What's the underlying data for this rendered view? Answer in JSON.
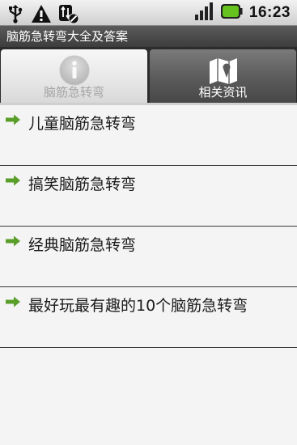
{
  "status_bar": {
    "time": "16:23",
    "icons": [
      "usb-icon",
      "warning-icon",
      "sync-disabled-icon",
      "signal-icon",
      "battery-icon"
    ]
  },
  "app": {
    "title": "脑筋急转弯大全及答案"
  },
  "tabs": [
    {
      "label": "脑筋急转弯",
      "icon": "info-icon",
      "active": true
    },
    {
      "label": "相关资讯",
      "icon": "map-icon",
      "active": false
    }
  ],
  "list": {
    "items": [
      {
        "label": "儿童脑筋急转弯"
      },
      {
        "label": "搞笑脑筋急转弯"
      },
      {
        "label": "经典脑筋急转弯"
      },
      {
        "label": "最好玩最有趣的10个脑筋急转弯"
      }
    ],
    "item_icon": "green-arrow-icon"
  },
  "colors": {
    "title_bar": "#4a4a4a",
    "active_tab": "#e6e6e6",
    "inactive_tab": "#5a5a5a",
    "arrow": "#5a9e2a",
    "battery": "#66c21f"
  }
}
